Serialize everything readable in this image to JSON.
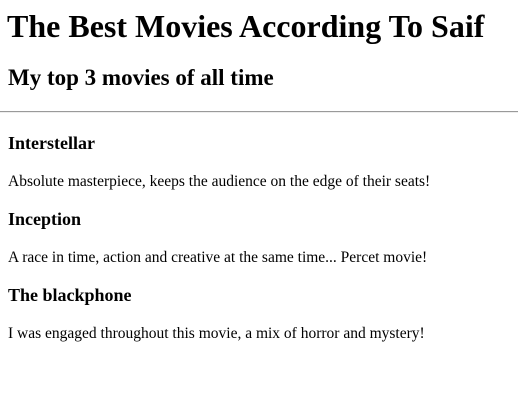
{
  "page": {
    "title": "The Best Movies According To Saif",
    "subtitle": "My top 3 movies of all time"
  },
  "movies": [
    {
      "title": "Interstellar",
      "description": "Absolute masterpiece, keeps the audience on the edge of their seats!"
    },
    {
      "title": "Inception",
      "description": "A race in time, action and creative at the same time... Percet movie!"
    },
    {
      "title": "The blackphone",
      "description": "I was engaged throughout this movie, a mix of horror and mystery!"
    }
  ]
}
